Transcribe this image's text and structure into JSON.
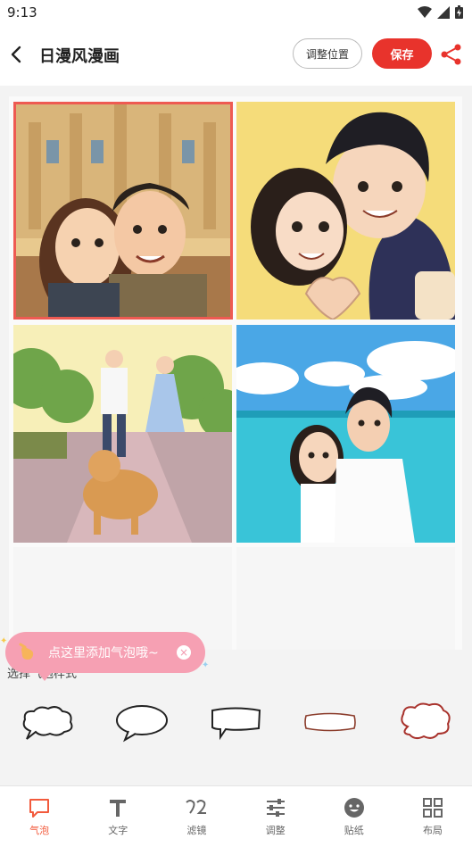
{
  "status_bar": {
    "time": "9:13"
  },
  "header": {
    "title": "日漫风漫画",
    "adjust_label": "调整位置",
    "save_label": "保存"
  },
  "tooltip": {
    "text": "点这里添加气泡哦~",
    "close": "×"
  },
  "bubble_section": {
    "label": "选择气泡样式"
  },
  "tabs": [
    {
      "label": "气泡",
      "icon": "speech-bubble-icon",
      "active": true
    },
    {
      "label": "文字",
      "icon": "text-icon",
      "active": false
    },
    {
      "label": "滤镜",
      "icon": "filter-icon",
      "active": false
    },
    {
      "label": "调整",
      "icon": "sliders-icon",
      "active": false
    },
    {
      "label": "贴纸",
      "icon": "sticker-icon",
      "active": false
    },
    {
      "label": "布局",
      "icon": "layout-icon",
      "active": false
    }
  ],
  "colors": {
    "accent": "#e8332c",
    "active_tab": "#f25a3c",
    "tooltip": "#f6a0b3"
  }
}
